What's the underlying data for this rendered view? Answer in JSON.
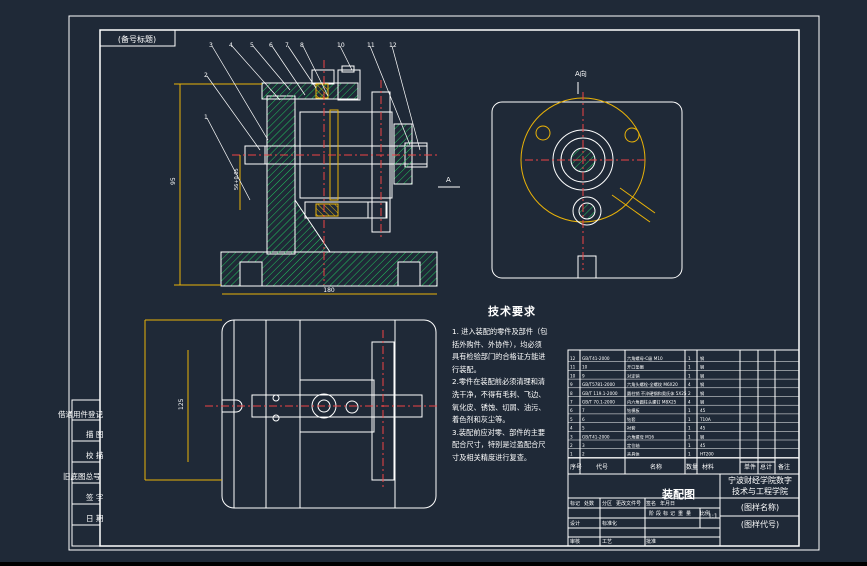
{
  "colors": {
    "background": "#1f2937",
    "frame": "#ffffff",
    "hatch": "#22c55e",
    "centerline": "#ef4444",
    "dimension": "#eab308",
    "parts": "#ffffff"
  },
  "drawing": {
    "corner_label": "(备号标题)",
    "view_label": "A向",
    "section_letter": "A",
    "part_numbers": [
      "3",
      "4",
      "5",
      "6",
      "7",
      "8",
      "10",
      "11",
      "12",
      "2",
      "1"
    ],
    "dim_height": "95",
    "dim_width": "180",
    "dim_small": "56+0.05",
    "dim_plan": "125"
  },
  "tech_requirements": {
    "title": "技术要求",
    "lines": [
      "1. 进入装配的零件及部件（包",
      "括外购件、外协件），均必须",
      "具有检验部门的合格证方能进",
      "行装配。",
      "2.零件在装配前必须清理和清",
      "洗干净，不得有毛刺、飞边、",
      "氧化皮、锈蚀、切屑、油污、",
      "着色剂和灰尘等。",
      "3.装配前应对零、部件的主要",
      "配合尺寸，特别是过盈配合尺",
      "寸及相关精度进行复查。"
    ]
  },
  "side_table": {
    "labels": [
      "借通用件登记",
      "描 图",
      "校 描",
      "旧底图总号",
      "签 字",
      "日 期"
    ]
  },
  "title_block": {
    "header": [
      "序号",
      "代号",
      "名称",
      "数量",
      "材料",
      "单件",
      "总计",
      "备注"
    ],
    "drawing_type": "装配图",
    "school": "宁波财经学院数字",
    "school_line2": "技术与工程学院",
    "drawing_name": "(图样名称)",
    "drawing_code": "(图样代号)",
    "stage_labels": [
      "阶",
      "段",
      "标",
      "记",
      "重",
      "量",
      "比例"
    ],
    "scale": "1:1",
    "sign_labels": [
      "标记",
      "处数",
      "分区",
      "更改文件号",
      "签名",
      "年月日",
      "设计",
      "审核",
      "工艺",
      "标准化",
      "批准"
    ],
    "rows": [
      {
        "no": "12",
        "code": "GB/T41-2000",
        "name": "六角螺母-C级 M10",
        "qty": "1",
        "mat": "钢"
      },
      {
        "no": "11",
        "code": "10",
        "name": "开口垫圈",
        "qty": "1",
        "mat": "钢"
      },
      {
        "no": "10",
        "code": "9",
        "name": "对定销",
        "qty": "1",
        "mat": "钢"
      },
      {
        "no": "9",
        "code": "GB/T5781-2000",
        "name": "六角头螺栓-全螺纹 M6X20",
        "qty": "4",
        "mat": "钢"
      },
      {
        "no": "8",
        "code": "GB/T 119.1-2000",
        "name": "圆柱销 不淬硬钢和奥氏体 5X25",
        "qty": "2",
        "mat": "钢"
      },
      {
        "no": "7",
        "code": "GB/T 70.1-2000",
        "name": "内六角圆柱头螺钉 M8X25",
        "qty": "4",
        "mat": "钢"
      },
      {
        "no": "6",
        "code": "7",
        "name": "钻模板",
        "qty": "1",
        "mat": "45"
      },
      {
        "no": "5",
        "code": "6",
        "name": "钻套",
        "qty": "1",
        "mat": "T10A"
      },
      {
        "no": "4",
        "code": "5",
        "name": "衬套",
        "qty": "1",
        "mat": "45"
      },
      {
        "no": "3",
        "code": "GB/T41-2000",
        "name": "六角螺母 M16",
        "qty": "1",
        "mat": "钢"
      },
      {
        "no": "2",
        "code": "3",
        "name": "定位轴",
        "qty": "1",
        "mat": "45"
      },
      {
        "no": "1",
        "code": "2",
        "name": "夹具体",
        "qty": "1",
        "mat": "HT200"
      }
    ]
  }
}
